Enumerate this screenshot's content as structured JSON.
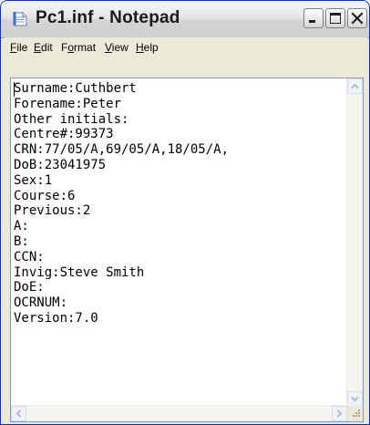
{
  "window": {
    "title": "Pc1.inf - Notepad",
    "app_icon": "notepad-icon"
  },
  "caption_buttons": {
    "minimize_icon": "minimize-icon",
    "maximize_icon": "maximize-icon",
    "close_icon": "close-icon"
  },
  "menu": [
    {
      "pre": "",
      "ul": "F",
      "post": "ile"
    },
    {
      "pre": "",
      "ul": "E",
      "post": "dit"
    },
    {
      "pre": "F",
      "ul": "o",
      "post": "rmat"
    },
    {
      "pre": "",
      "ul": "V",
      "post": "iew"
    },
    {
      "pre": "",
      "ul": "H",
      "post": "elp"
    }
  ],
  "document": {
    "lines": [
      "Surname:Cuthbert",
      "Forename:Peter",
      "Other initials:",
      "Centre#:99373",
      "CRN:77/05/A,69/05/A,18/05/A,",
      "DoB:23041975",
      "Sex:1",
      "Course:6",
      "Previous:2",
      "A:",
      "B:",
      "CCN:",
      "Invig:Steve Smith",
      "DoE:",
      "OCRNUM:",
      "Version:7.0"
    ]
  },
  "scrollbars": {
    "up_icon": "scroll-up-arrow-icon",
    "down_icon": "scroll-down-arrow-icon",
    "left_icon": "scroll-left-arrow-icon",
    "right_icon": "scroll-right-arrow-icon",
    "grip_icon": "resize-grip-icon"
  },
  "colors": {
    "frame": "#0831d9",
    "face": "#ece9d8"
  }
}
